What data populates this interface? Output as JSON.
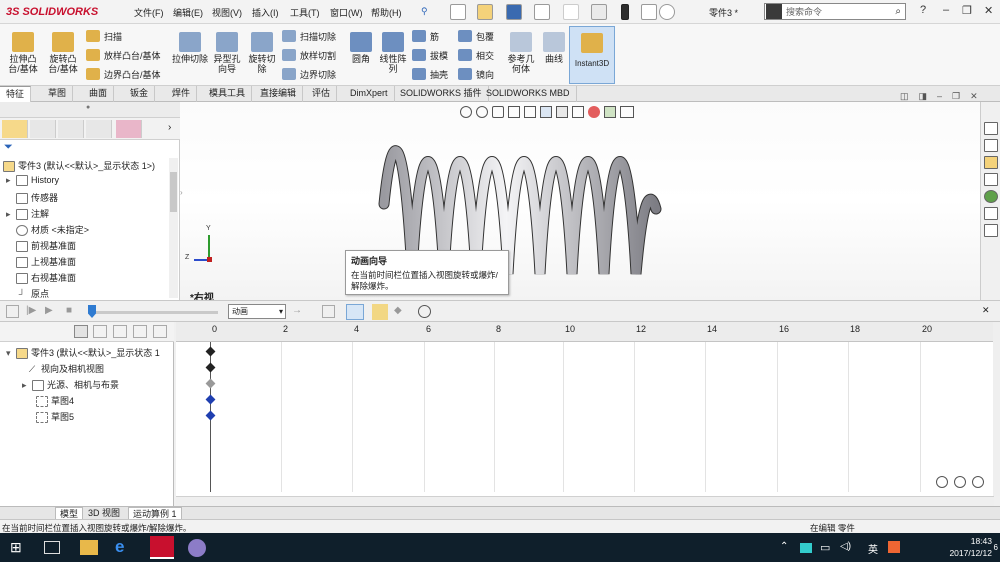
{
  "app": {
    "logo_text": "SOLIDWORKS",
    "doc_name": "零件3 *"
  },
  "menu": [
    "文件(F)",
    "编辑(E)",
    "视图(V)",
    "插入(I)",
    "工具(T)",
    "窗口(W)",
    "帮助(H)"
  ],
  "search": {
    "placeholder": "搜索命令"
  },
  "ribbon": {
    "big": [
      "拉伸凸台/基体",
      "旋转凸台/基体",
      "拉伸切除",
      "异型孔向导",
      "旋转切除",
      "圆角",
      "线性阵列",
      "参考几何体",
      "曲线"
    ],
    "small": [
      "扫描",
      "放样凸台/基体",
      "边界凸台/基体",
      "扫描切除",
      "放样切割",
      "边界切除",
      "筋",
      "拔模",
      "抽壳",
      "包覆",
      "相交",
      "镜向"
    ],
    "instant3d": "Instant3D"
  },
  "tabs": [
    "特征",
    "草图",
    "曲面",
    "钣金",
    "焊件",
    "模具工具",
    "直接编辑",
    "评估",
    "DimXpert",
    "SOLIDWORKS 插件",
    "SOLIDWORKS MBD"
  ],
  "tree": {
    "root": "零件3 (默认<<默认>_显示状态 1>)",
    "items": [
      "History",
      "传感器",
      "注解",
      "材质 <未指定>",
      "前视基准面",
      "上视基准面",
      "右视基准面",
      "原点"
    ]
  },
  "viewport": {
    "view_label": "*右视",
    "axis_y": "Y",
    "axis_z": "Z"
  },
  "tooltip": {
    "title": "动画向导",
    "desc": "在当前时间栏位置插入视图旋转或爆炸/解除爆炸。"
  },
  "motion": {
    "type_value": "动画",
    "tree_root": "零件3 (默认<<默认>_显示状态 1",
    "tree_items": [
      "视向及相机视图",
      "光源、相机与布景",
      "草图4",
      "草图5"
    ],
    "ruler": [
      "0",
      "2",
      "4",
      "6",
      "8",
      "10",
      "12",
      "14",
      "16",
      "18",
      "20"
    ]
  },
  "bottom_tabs": [
    "模型",
    "3D 视图",
    "运动算例 1"
  ],
  "status": {
    "text": "在当前时间栏位置插入视图旋转或爆炸/解除爆炸。",
    "right": "在编辑 零件"
  },
  "taskbar": {
    "time": "18:43",
    "date": "2017/12/12",
    "ime": "英",
    "notify_count": "6"
  },
  "colors": {
    "accent": "#c8102e",
    "selection": "#cfe1f5",
    "keyframe": "#1f3fb0"
  }
}
